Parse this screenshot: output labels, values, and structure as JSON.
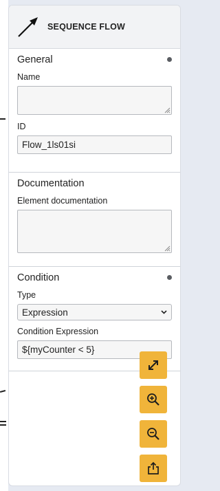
{
  "colors": {
    "accent": "#f0b43a",
    "panel_bg": "#ffffff",
    "header_bg": "#f2f3f5",
    "field_bg": "#f6f6f6"
  },
  "header": {
    "title": "SEQUENCE FLOW",
    "icon": "sequence-flow-arrow-icon"
  },
  "general": {
    "title": "General",
    "name_label": "Name",
    "name_value": "",
    "id_label": "ID",
    "id_value": "Flow_1ls01si"
  },
  "documentation": {
    "title": "Documentation",
    "element_doc_label": "Element documentation",
    "element_doc_value": ""
  },
  "condition": {
    "title": "Condition",
    "type_label": "Type",
    "type_value": "Expression",
    "expression_label": "Condition Expression",
    "expression_value": "${myCounter < 5}"
  },
  "tools": [
    {
      "icon": "fullscreen-icon"
    },
    {
      "icon": "zoom-in-icon"
    },
    {
      "icon": "zoom-out-icon"
    },
    {
      "icon": "export-icon"
    }
  ]
}
